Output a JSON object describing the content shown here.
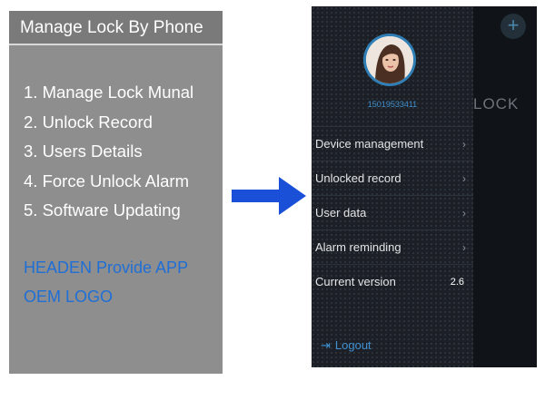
{
  "info_panel": {
    "title": "Manage Lock By Phone",
    "features": [
      "1. Manage Lock Munal",
      "2. Unlock Record",
      "3. Users Details",
      "4. Force Unlock Alarm",
      "5. Software Updating"
    ],
    "oem_line1": "HEADEN Provide APP",
    "oem_line2": "OEM LOGO"
  },
  "phone": {
    "add_icon": "plus-icon",
    "background_title": "LOCK",
    "account_number": "15019533411",
    "menu": [
      {
        "label": "Device management",
        "icon": "chevron-right-icon"
      },
      {
        "label": "Unlocked record",
        "icon": "chevron-right-icon"
      },
      {
        "label": "User data",
        "icon": "chevron-right-icon"
      },
      {
        "label": "Alarm reminding",
        "icon": "chevron-right-icon"
      },
      {
        "label": "Current version",
        "value": "2.6"
      }
    ],
    "logout_label": "Logout",
    "chevron": "›",
    "plus": "+",
    "logout_glyph": "⇥"
  },
  "colors": {
    "panel_gray": "#8e8e8e",
    "oem_blue": "#1f6fd6",
    "arrow_blue": "#1a4fd8",
    "app_accent": "#3f8fd0"
  }
}
